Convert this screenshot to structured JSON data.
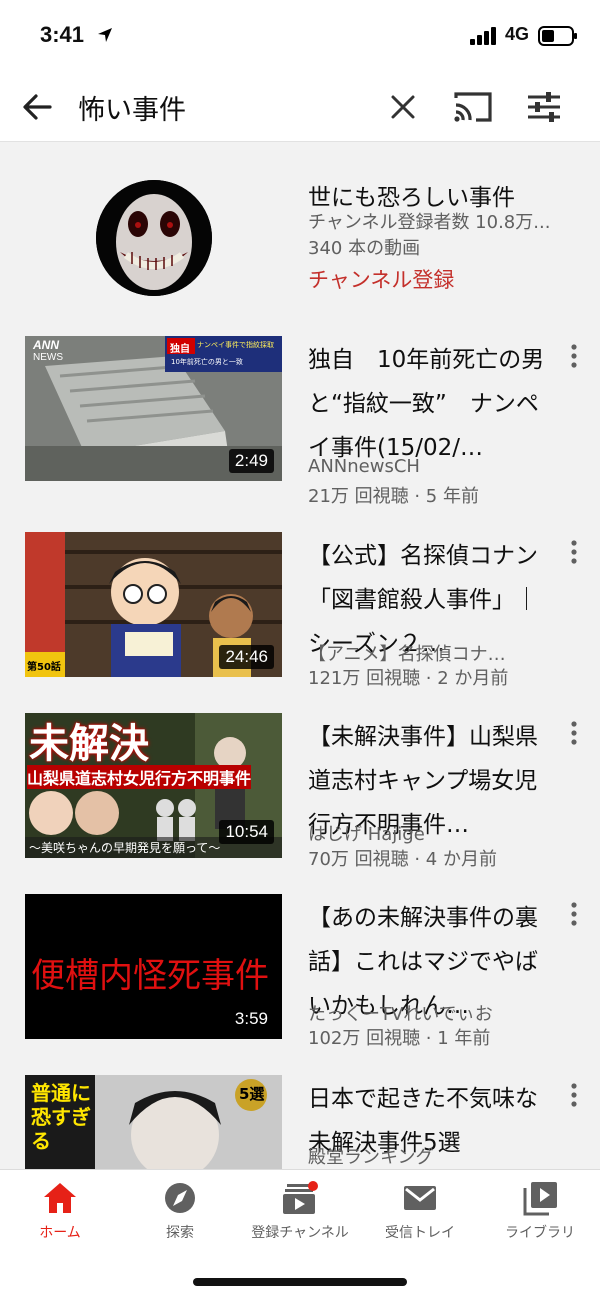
{
  "status": {
    "time": "3:41",
    "network": "4G"
  },
  "search": {
    "query": "怖い事件"
  },
  "channel": {
    "name": "世にも恐ろしい事件",
    "subscribers": "チャンネル登録者数 10.8万...",
    "video_count": "340 本の動画",
    "subscribe_label": "チャンネル登録"
  },
  "videos": [
    {
      "title": "独自　10年前死亡の男と“指紋一致”　ナンペイ事件(15/02/…",
      "channel": "ANNnewsCH",
      "meta": "21万 回視聴 · 5 年前",
      "duration": "2:49"
    },
    {
      "title": "【公式】名探偵コナン「図書館殺人事件」｜　シーズン２…",
      "channel": "【アニメ】名探偵コナ…",
      "meta": "121万 回視聴 · 2 か月前",
      "duration": "24:46"
    },
    {
      "title": "【未解決事件】山梨県道志村キャンプ場女児行方不明事件…",
      "channel": "はじげ Hajige",
      "meta": "70万 回視聴 · 4 か月前",
      "duration": "10:54"
    },
    {
      "title": "【あの未解決事件の裏話】これはマジでやばいかもしれん…",
      "channel": "たっくーTVれいでぃお",
      "meta": "102万 回視聴 · 1 年前",
      "duration": "3:59"
    },
    {
      "title": "日本で起きた不気味な未解決事件5選",
      "channel": "殿堂ランキング",
      "meta": "",
      "duration": ""
    }
  ],
  "thumb_text": {
    "t1_logo": "ANN",
    "t1_news": "NEWS",
    "t1_badge": "独自",
    "t1_cap1": "ナンペイ事件で指紋採取",
    "t1_cap2": "10年前死亡の男と一致",
    "t2_ep": "第50話",
    "t3_big": "未解決",
    "t3_sub": "山梨県道志村女児行方不明事件",
    "t3_bottom": "〜美咲ちゃんの早期発見を願って〜",
    "t4_text": "便槽内怪死事件",
    "t5_badge": "5選",
    "t5_text": "普通に恐すぎる"
  },
  "tabs": [
    {
      "label": "ホーム",
      "icon": "home-icon",
      "active": true
    },
    {
      "label": "探索",
      "icon": "explore-icon",
      "active": false
    },
    {
      "label": "登録チャンネル",
      "icon": "subscriptions-icon",
      "active": false
    },
    {
      "label": "受信トレイ",
      "icon": "inbox-icon",
      "active": false
    },
    {
      "label": "ライブラリ",
      "icon": "library-icon",
      "active": false
    }
  ],
  "colors": {
    "accent": "#e62117",
    "subscribe": "#c4302b",
    "secondary_text": "#606060"
  }
}
